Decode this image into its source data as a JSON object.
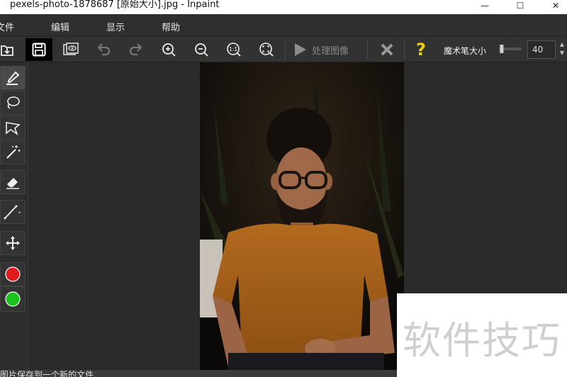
{
  "window": {
    "title": "pexels-photo-1878687 [原始大小].jpg - Inpaint",
    "controls": {
      "minimize": "—",
      "maximize": "☐",
      "close": "✕"
    }
  },
  "menu": {
    "items": [
      {
        "label": "文件"
      },
      {
        "label": "编辑"
      },
      {
        "label": "显示"
      },
      {
        "label": "帮助"
      }
    ]
  },
  "toolbar": {
    "process_label": "处理图像",
    "help_label": "?",
    "brush_size_label": "魔术笔大小",
    "brush_size_value": "40",
    "zoom_actual_label": "1:1",
    "slider_level_fraction": 0.05
  },
  "tools": [
    {
      "name": "marker"
    },
    {
      "name": "lasso"
    },
    {
      "name": "polygon-lasso"
    },
    {
      "name": "magic-wand"
    },
    {
      "name": "eraser"
    },
    {
      "name": "line"
    },
    {
      "name": "move"
    },
    {
      "name": "red-marker"
    },
    {
      "name": "green-marker"
    }
  ],
  "colors": {
    "accent_yellow": "#f2d000",
    "red_marker": "#e11b1b",
    "green_marker": "#1dc31d",
    "process_arrow": "#8c8c8c"
  },
  "statusbar": {
    "message": "图片保存到一个新的文件"
  },
  "watermark": {
    "text": "软件技巧"
  }
}
